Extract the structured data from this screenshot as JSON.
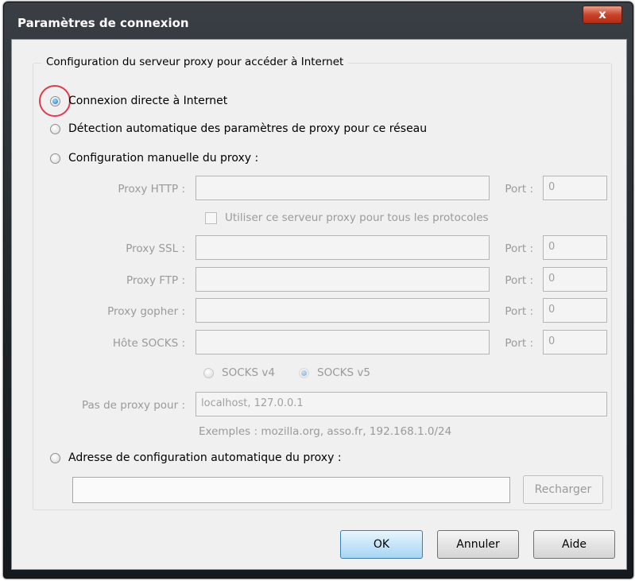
{
  "window": {
    "title": "Paramètres de connexion",
    "close_symbol": "x"
  },
  "group": {
    "legend": "Configuration du serveur proxy pour accéder à Internet"
  },
  "options": {
    "direct": "Connexion directe à Internet",
    "auto_detect": "Détection automatique des paramètres de proxy pour ce réseau",
    "manual": "Configuration manuelle du proxy :",
    "auto_config_url": "Adresse de configuration automatique du proxy :"
  },
  "selected_option": "direct",
  "manual": {
    "http_label": "Proxy HTTP :",
    "http_value": "",
    "http_port_label": "Port :",
    "http_port_value": "0",
    "share_label": "Utiliser ce serveur proxy pour tous les protocoles",
    "ssl_label": "Proxy SSL :",
    "ssl_value": "",
    "ssl_port_label": "Port :",
    "ssl_port_value": "0",
    "ftp_label": "Proxy FTP :",
    "ftp_value": "",
    "ftp_port_label": "Port :",
    "ftp_port_value": "0",
    "gopher_label": "Proxy gopher :",
    "gopher_value": "",
    "gopher_port_label": "Port :",
    "gopher_port_value": "0",
    "socks_label": "Hôte SOCKS :",
    "socks_value": "",
    "socks_port_label": "Port :",
    "socks_port_value": "0",
    "socks_v4": "SOCKS v4",
    "socks_v5": "SOCKS v5",
    "socks_selected": "v5",
    "no_proxy_label": "Pas de proxy pour :",
    "no_proxy_value": "localhost, 127.0.0.1",
    "examples": "Exemples : mozilla.org, asso.fr, 192.168.1.0/24"
  },
  "auto_config": {
    "url_value": "",
    "reload_label": "Recharger"
  },
  "buttons": {
    "ok": "OK",
    "cancel": "Annuler",
    "help": "Aide"
  }
}
